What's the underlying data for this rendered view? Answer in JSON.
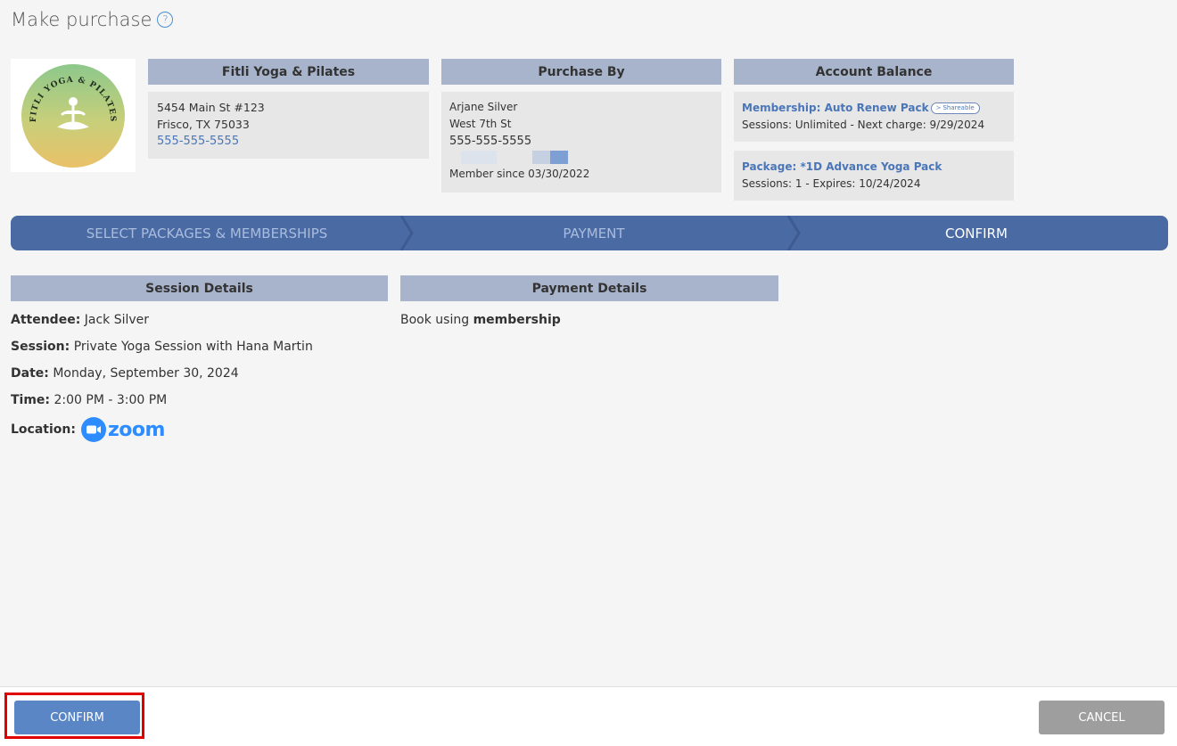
{
  "page": {
    "title": "Make purchase"
  },
  "studio": {
    "header": "Fitli Yoga & Pilates",
    "address1": "5454 Main St #123",
    "address2": "Frisco, TX 75033",
    "phone": "555-555-5555",
    "logo_text": "FITLI YOGA & PILATES"
  },
  "purchaser": {
    "header": "Purchase By",
    "name": "Arjane Silver",
    "street": "West 7th St",
    "phone": "555-555-5555",
    "member_since": "Member since 03/30/2022"
  },
  "account": {
    "header": "Account Balance",
    "items": [
      {
        "name": "Membership: Auto Renew Pack",
        "badge": "Shareable",
        "detail": "Sessions: Unlimited -  Next charge: 9/29/2024"
      },
      {
        "name": "Package: *1D Advance Yoga Pack",
        "detail": "Sessions: 1 -  Expires: 10/24/2024"
      }
    ]
  },
  "steps": [
    {
      "label": "SELECT PACKAGES & MEMBERSHIPS",
      "state": "done"
    },
    {
      "label": "PAYMENT",
      "state": "done"
    },
    {
      "label": "CONFIRM",
      "state": "current"
    }
  ],
  "session": {
    "header": "Session Details",
    "attendee_label": "Attendee:",
    "attendee": "Jack Silver",
    "session_label": "Session:",
    "session": "Private Yoga Session with Hana Martin",
    "date_label": "Date:",
    "date": "Monday, September 30, 2024",
    "time_label": "Time:",
    "time": "2:00 PM - 3:00 PM",
    "location_label": "Location:",
    "location": "zoom"
  },
  "payment": {
    "header": "Payment Details",
    "text_prefix": "Book using",
    "method": "membership"
  },
  "footer": {
    "confirm": "CONFIRM",
    "cancel": "CANCEL"
  },
  "colors": {
    "step_bar": "#4a6aa4",
    "header_bg": "#a8b4cb",
    "confirm_btn": "#5b86c6",
    "cancel_btn": "#9e9e9e",
    "link": "#4a76b8",
    "highlight": "#e00000"
  }
}
